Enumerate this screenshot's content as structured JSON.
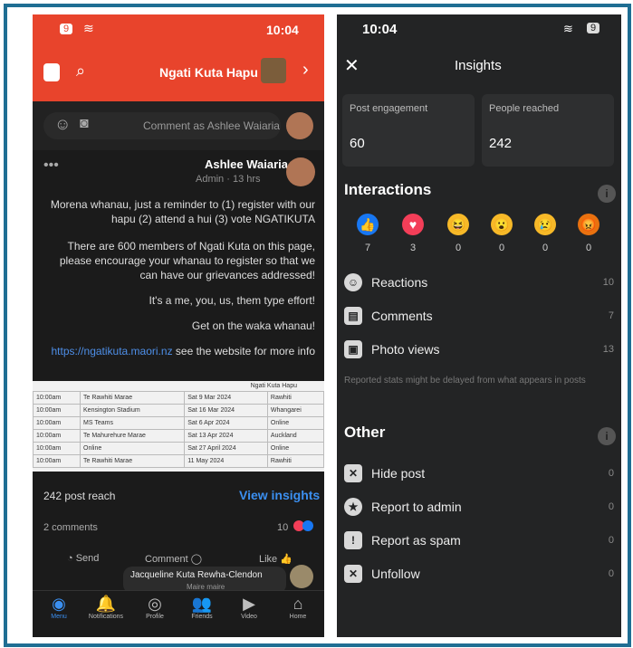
{
  "left": {
    "status": {
      "time": "10:04",
      "battery": "9"
    },
    "header": {
      "title": "Ngati Kuta Hapu"
    },
    "comment_placeholder": "Comment as Ashlee Waiaria",
    "post": {
      "author": "Ashlee Waiaria",
      "meta": "Admin · 13 hrs",
      "p1": "Morena whanau, just a reminder to (1) register with our hapu (2) attend a hui (3) vote NGATIKUTA",
      "p2": "There are 600 members of Ngati Kuta on this page, please encourage your whanau to register so that we can have our grievances addressed!",
      "p3": "It's a me, you, us, them type effort!",
      "p4": "Get on the waka whanau!",
      "link": "https://ngatikuta.maori.nz",
      "link_suffix": " see the website for more info"
    },
    "table": {
      "title": "Ngati Kuta Hapu",
      "rows": [
        [
          "Rawhiti",
          "Sat 9 Mar 2024",
          "Te Rawhiti Marae",
          "10:00am"
        ],
        [
          "Whangarei",
          "Sat 16 Mar 2024",
          "Kensington Stadium",
          "10:00am"
        ],
        [
          "Online",
          "Sat 6 Apr 2024",
          "MS Teams",
          "10:00am"
        ],
        [
          "Auckland",
          "Sat 13 Apr 2024",
          "Te Mahurehure Marae",
          "10:00am"
        ],
        [
          "Online",
          "Sat 27 April 2024",
          "Online",
          "10:00am"
        ],
        [
          "Rawhiti",
          "11 May 2024",
          "Te Rawhiti Marae",
          "10:00am"
        ]
      ]
    },
    "insights": {
      "reach": "242 post reach",
      "link": "View insights"
    },
    "reactions": {
      "count": "10",
      "comments": "2 comments"
    },
    "actions": {
      "like": "Like",
      "comment": "Comment",
      "send": "Send"
    },
    "comment": {
      "author": "Jacqueline Kuta Rewha-Clendon",
      "sub": "Maire maire"
    },
    "nav": [
      {
        "label": "Home",
        "icon": "⌂"
      },
      {
        "label": "Video",
        "icon": "▶"
      },
      {
        "label": "Friends",
        "icon": "👥"
      },
      {
        "label": "Profile",
        "icon": "◎"
      },
      {
        "label": "Notifications",
        "icon": "🔔"
      },
      {
        "label": "Menu",
        "icon": "◉"
      }
    ]
  },
  "right": {
    "status": {
      "time": "10:04",
      "battery": "9"
    },
    "title": "Insights",
    "post_engagement": {
      "label": "Post engagement",
      "value": "60"
    },
    "people_reached": {
      "label": "People reached",
      "value": "242"
    },
    "interactions_title": "Interactions",
    "emojis": [
      {
        "icon": "👍",
        "bg": "#1877f2",
        "count": "7"
      },
      {
        "icon": "♥",
        "bg": "#f33e58",
        "count": "3"
      },
      {
        "icon": "😆",
        "bg": "#f7b928",
        "count": "0"
      },
      {
        "icon": "😮",
        "bg": "#f7b928",
        "count": "0"
      },
      {
        "icon": "😢",
        "bg": "#f7b928",
        "count": "0"
      },
      {
        "icon": "😡",
        "bg": "#e9710f",
        "count": "0"
      }
    ],
    "interactions": [
      {
        "label": "Reactions",
        "icon": "☺",
        "count": "10"
      },
      {
        "label": "Comments",
        "icon": "▤",
        "count": "7"
      },
      {
        "label": "Photo views",
        "icon": "▣",
        "count": "13"
      }
    ],
    "note": "Reported stats might be delayed from what appears in posts",
    "other_title": "Other",
    "other": [
      {
        "label": "Hide post",
        "icon": "✕",
        "count": "0"
      },
      {
        "label": "Report to admin",
        "icon": "★",
        "count": "0"
      },
      {
        "label": "Report as spam",
        "icon": "!",
        "count": "0"
      },
      {
        "label": "Unfollow",
        "icon": "✕",
        "count": "0"
      }
    ]
  }
}
